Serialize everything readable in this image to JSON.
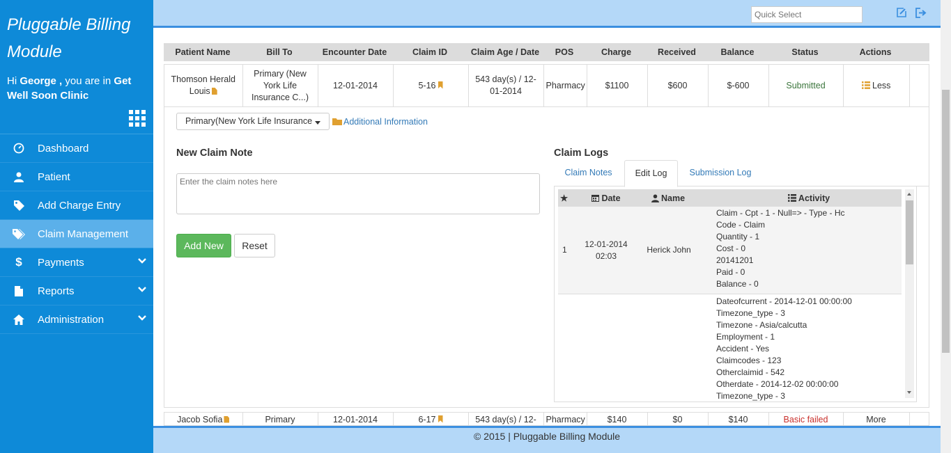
{
  "sidebar": {
    "brand": "Pluggable Billing Module",
    "greet_prefix": "Hi ",
    "user": "George ,",
    "greet_mid": " you are in ",
    "clinic": "Get Well Soon Clinic",
    "items": [
      {
        "label": "Dashboard",
        "icon": "dashboard-icon"
      },
      {
        "label": "Patient",
        "icon": "user-icon"
      },
      {
        "label": "Add Charge Entry",
        "icon": "tag-icon"
      },
      {
        "label": "Claim Management",
        "icon": "tags-icon"
      },
      {
        "label": "Payments",
        "icon": "dollar-icon"
      },
      {
        "label": "Reports",
        "icon": "file-icon"
      },
      {
        "label": "Administration",
        "icon": "home-icon"
      }
    ]
  },
  "topbar": {
    "quick_select_placeholder": "Quick Select"
  },
  "table": {
    "headers": [
      "Patient Name",
      "Bill To",
      "Encounter Date",
      "Claim ID",
      "Claim Age / Date",
      "POS",
      "Charge",
      "Received",
      "Balance",
      "Status",
      "Actions"
    ],
    "rows": [
      {
        "patient": "Thomson Herald Louis",
        "bill_to": "Primary (New York Life Insurance C...)",
        "encounter_date": "12-01-2014",
        "claim_id": "5-16",
        "claim_age": "543 day(s) / 12-01-2014",
        "pos": "Pharmacy",
        "charge": "$1100",
        "received": "$600",
        "balance": "$-600",
        "status": "Submitted",
        "action": "Less"
      },
      {
        "patient": "Jacob Sofia",
        "bill_to": "Primary",
        "encounter_date": "12-01-2014",
        "claim_id": "6-17",
        "claim_age": "543 day(s) / 12-",
        "pos": "Pharmacy",
        "charge": "$140",
        "received": "$0",
        "balance": "$140",
        "status": "Basic failed",
        "action": "More"
      }
    ]
  },
  "detail": {
    "payer_select": "Primary(New York Life Insurance",
    "additional_info": "Additional Information",
    "note_title": "New Claim Note",
    "note_placeholder": "Enter the claim notes here",
    "add_button": "Add New",
    "reset_button": "Reset",
    "logs_title": "Claim Logs",
    "tabs": [
      "Claim Notes",
      "Edit Log",
      "Submission Log"
    ],
    "active_tab": "Edit Log",
    "log_headers": {
      "date": "Date",
      "name": "Name",
      "activity": "Activity"
    },
    "log_rows": [
      {
        "num": "1",
        "date": "12-01-2014 02:03",
        "name": "Herick John",
        "activity": [
          "Claim - Cpt - 1 - Null=> - Type - Hc",
          "Code - Claim",
          "Quantity - 1",
          "Cost - 0",
          "20141201",
          "Paid - 0",
          "Balance - 0"
        ]
      },
      {
        "num": "",
        "date": "",
        "name": "",
        "activity": [
          "Dateofcurrent - 2014-12-01 00:00:00",
          "Timezone_type - 3",
          "Timezone - Asia/calcutta",
          "Employment - 1",
          "Accident - Yes",
          "Claimcodes - 123",
          "Otherclaimid - 542",
          "Otherdate - 2014-12-02 00:00:00",
          "Timezone_type - 3"
        ]
      }
    ]
  },
  "footer": {
    "text": "© 2015 | Pluggable Billing Module"
  },
  "colors": {
    "sidebar_bg": "#0e8ad8",
    "sidebar_active": "#5bb0ea",
    "topbar_bg": "#b4d8f8",
    "accent": "#3b8fe0",
    "success": "#5cb85c",
    "link": "#337ab7"
  }
}
